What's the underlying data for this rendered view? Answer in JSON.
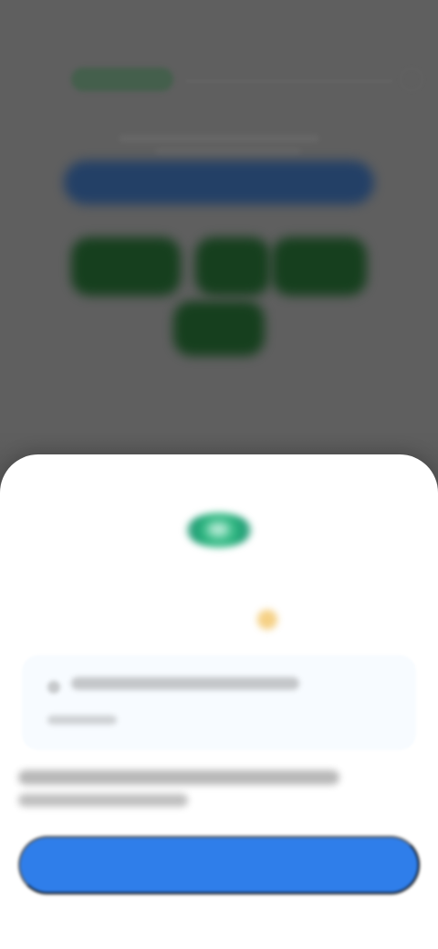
{
  "status": {
    "time": ""
  },
  "sheet": {
    "title": "",
    "continue_label": ""
  },
  "colors": {
    "answer_blue": "#213f67",
    "choice_green": "#153f1d",
    "continue_blue": "#2f7eea",
    "sheet_bg": "#ffffff"
  },
  "icons": {
    "sheet_icon": "celebration-icon",
    "sparkle": "sparkle-icon"
  }
}
